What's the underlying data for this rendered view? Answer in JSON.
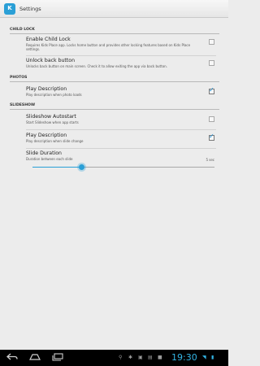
{
  "app": {
    "title": "Settings",
    "icon_text": "K"
  },
  "sections": {
    "child_lock": {
      "header": "CHILD LOCK",
      "enable_child_lock": {
        "title": "Enable Child Lock",
        "summary": "Requires Kids Place app. Locks home button and provides other locking features based on Kids Place settings.",
        "checked": false
      },
      "unlock_back_button": {
        "title": "Unlock back button",
        "summary": "Unlocks back button on main screen. Check it to allow exiting the app via back button.",
        "checked": false
      }
    },
    "photos": {
      "header": "PHOTOS",
      "play_description": {
        "title": "Play Description",
        "summary": "Play description when photo loads",
        "checked": true
      }
    },
    "slideshow": {
      "header": "SLIDESHOW",
      "autostart": {
        "title": "Slideshow Autostart",
        "summary": "Start Slideshow when app starts",
        "checked": false
      },
      "play_description": {
        "title": "Play Description",
        "summary": "Play description when slide change",
        "checked": true
      },
      "duration": {
        "title": "Slide Duration",
        "summary": "Duration between each slide",
        "value_label": "5 sec",
        "slider_fraction": 0.27
      }
    }
  },
  "navbar": {
    "back_icon": "back-arrow-icon",
    "home_icon": "home-icon",
    "recents_icon": "recent-apps-icon",
    "clock": "19:30",
    "accent_color": "#33b5e5"
  }
}
